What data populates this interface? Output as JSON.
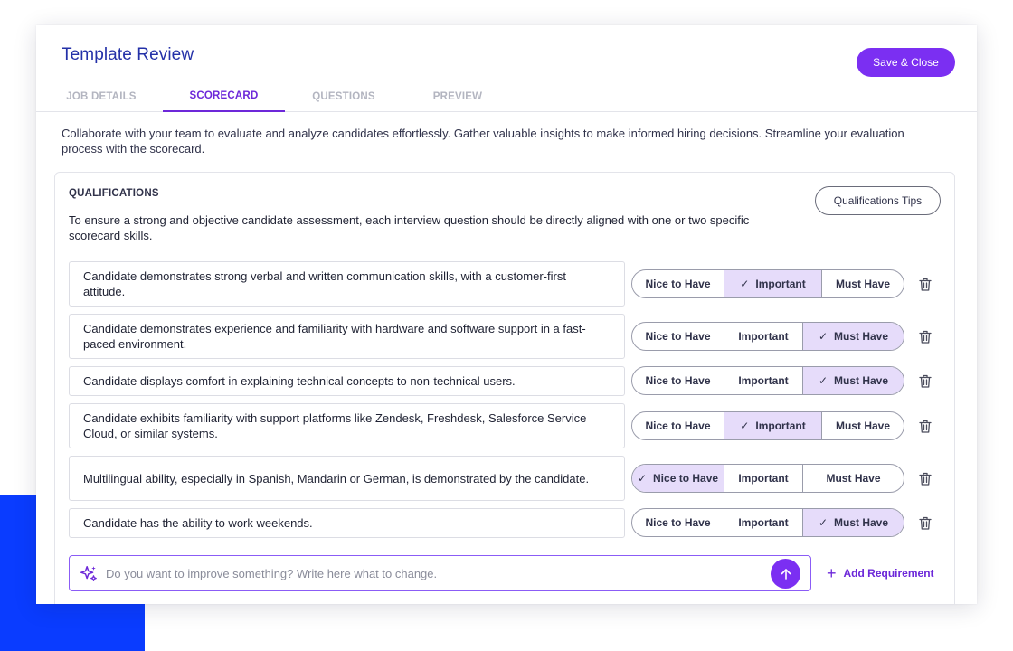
{
  "header": {
    "title": "Template Review",
    "save_label": "Save & Close"
  },
  "tabs": [
    {
      "label": "JOB DETAILS",
      "active": false
    },
    {
      "label": "SCORECARD",
      "active": true
    },
    {
      "label": "QUESTIONS",
      "active": false
    },
    {
      "label": "PREVIEW",
      "active": false
    }
  ],
  "intro": "Collaborate with your team to evaluate and analyze candidates effortlessly. Gather valuable insights to make informed hiring decisions. Streamline your evaluation process with the scorecard.",
  "qualifications": {
    "title": "QUALIFICATIONS",
    "tips_label": "Qualifications Tips",
    "description": "To ensure a strong and objective candidate assessment, each interview question should be directly aligned with one or two specific scorecard skills.",
    "priority_options": [
      "Nice to Have",
      "Important",
      "Must Have"
    ],
    "requirements": [
      {
        "text": "Candidate demonstrates strong verbal and written communication skills, with a customer-first attitude.",
        "selected": "Important"
      },
      {
        "text": "Candidate demonstrates experience and familiarity with hardware and software support in a fast-paced environment.",
        "selected": "Must Have"
      },
      {
        "text": "Candidate displays comfort in explaining technical concepts to non-technical users.",
        "selected": "Must Have"
      },
      {
        "text": "Candidate exhibits familiarity with support platforms like Zendesk, Freshdesk, Salesforce Service Cloud, or similar systems.",
        "selected": "Important"
      },
      {
        "text": "Multilingual ability, especially in Spanish, Mandarin or German, is demonstrated by the candidate.",
        "selected": "Nice to Have"
      },
      {
        "text": "Candidate has the ability to work weekends.",
        "selected": "Must Have"
      }
    ]
  },
  "ai_input": {
    "value": "",
    "placeholder": "Do you want to improve something? Write here what to change.",
    "icon": "sparkle-icon",
    "send_icon": "arrow-up-icon"
  },
  "add_requirement_label": "Add Requirement",
  "colors": {
    "brand": "#7b2ff2",
    "title": "#2431a8",
    "selected_bg": "#e6dcfa",
    "accent_block": "#0a3cff"
  }
}
